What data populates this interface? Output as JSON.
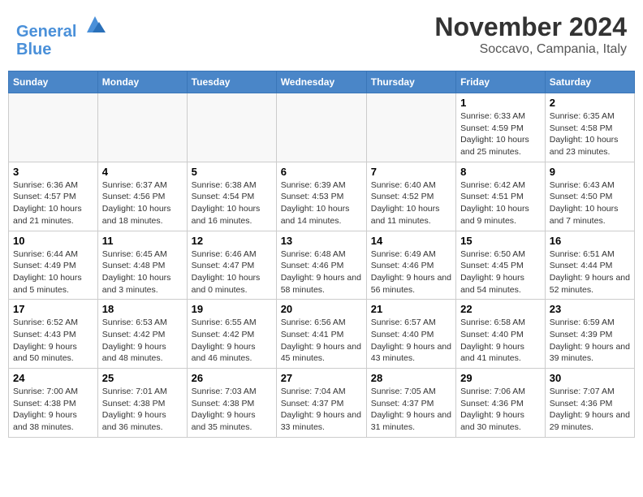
{
  "header": {
    "logo_line1": "General",
    "logo_line2": "Blue",
    "month_title": "November 2024",
    "location": "Soccavo, Campania, Italy"
  },
  "weekdays": [
    "Sunday",
    "Monday",
    "Tuesday",
    "Wednesday",
    "Thursday",
    "Friday",
    "Saturday"
  ],
  "weeks": [
    [
      {
        "day": "",
        "info": "",
        "empty": true
      },
      {
        "day": "",
        "info": "",
        "empty": true
      },
      {
        "day": "",
        "info": "",
        "empty": true
      },
      {
        "day": "",
        "info": "",
        "empty": true
      },
      {
        "day": "",
        "info": "",
        "empty": true
      },
      {
        "day": "1",
        "info": "Sunrise: 6:33 AM\nSunset: 4:59 PM\nDaylight: 10 hours and 25 minutes."
      },
      {
        "day": "2",
        "info": "Sunrise: 6:35 AM\nSunset: 4:58 PM\nDaylight: 10 hours and 23 minutes."
      }
    ],
    [
      {
        "day": "3",
        "info": "Sunrise: 6:36 AM\nSunset: 4:57 PM\nDaylight: 10 hours and 21 minutes."
      },
      {
        "day": "4",
        "info": "Sunrise: 6:37 AM\nSunset: 4:56 PM\nDaylight: 10 hours and 18 minutes."
      },
      {
        "day": "5",
        "info": "Sunrise: 6:38 AM\nSunset: 4:54 PM\nDaylight: 10 hours and 16 minutes."
      },
      {
        "day": "6",
        "info": "Sunrise: 6:39 AM\nSunset: 4:53 PM\nDaylight: 10 hours and 14 minutes."
      },
      {
        "day": "7",
        "info": "Sunrise: 6:40 AM\nSunset: 4:52 PM\nDaylight: 10 hours and 11 minutes."
      },
      {
        "day": "8",
        "info": "Sunrise: 6:42 AM\nSunset: 4:51 PM\nDaylight: 10 hours and 9 minutes."
      },
      {
        "day": "9",
        "info": "Sunrise: 6:43 AM\nSunset: 4:50 PM\nDaylight: 10 hours and 7 minutes."
      }
    ],
    [
      {
        "day": "10",
        "info": "Sunrise: 6:44 AM\nSunset: 4:49 PM\nDaylight: 10 hours and 5 minutes."
      },
      {
        "day": "11",
        "info": "Sunrise: 6:45 AM\nSunset: 4:48 PM\nDaylight: 10 hours and 3 minutes."
      },
      {
        "day": "12",
        "info": "Sunrise: 6:46 AM\nSunset: 4:47 PM\nDaylight: 10 hours and 0 minutes."
      },
      {
        "day": "13",
        "info": "Sunrise: 6:48 AM\nSunset: 4:46 PM\nDaylight: 9 hours and 58 minutes."
      },
      {
        "day": "14",
        "info": "Sunrise: 6:49 AM\nSunset: 4:46 PM\nDaylight: 9 hours and 56 minutes."
      },
      {
        "day": "15",
        "info": "Sunrise: 6:50 AM\nSunset: 4:45 PM\nDaylight: 9 hours and 54 minutes."
      },
      {
        "day": "16",
        "info": "Sunrise: 6:51 AM\nSunset: 4:44 PM\nDaylight: 9 hours and 52 minutes."
      }
    ],
    [
      {
        "day": "17",
        "info": "Sunrise: 6:52 AM\nSunset: 4:43 PM\nDaylight: 9 hours and 50 minutes."
      },
      {
        "day": "18",
        "info": "Sunrise: 6:53 AM\nSunset: 4:42 PM\nDaylight: 9 hours and 48 minutes."
      },
      {
        "day": "19",
        "info": "Sunrise: 6:55 AM\nSunset: 4:42 PM\nDaylight: 9 hours and 46 minutes."
      },
      {
        "day": "20",
        "info": "Sunrise: 6:56 AM\nSunset: 4:41 PM\nDaylight: 9 hours and 45 minutes."
      },
      {
        "day": "21",
        "info": "Sunrise: 6:57 AM\nSunset: 4:40 PM\nDaylight: 9 hours and 43 minutes."
      },
      {
        "day": "22",
        "info": "Sunrise: 6:58 AM\nSunset: 4:40 PM\nDaylight: 9 hours and 41 minutes."
      },
      {
        "day": "23",
        "info": "Sunrise: 6:59 AM\nSunset: 4:39 PM\nDaylight: 9 hours and 39 minutes."
      }
    ],
    [
      {
        "day": "24",
        "info": "Sunrise: 7:00 AM\nSunset: 4:38 PM\nDaylight: 9 hours and 38 minutes."
      },
      {
        "day": "25",
        "info": "Sunrise: 7:01 AM\nSunset: 4:38 PM\nDaylight: 9 hours and 36 minutes."
      },
      {
        "day": "26",
        "info": "Sunrise: 7:03 AM\nSunset: 4:38 PM\nDaylight: 9 hours and 35 minutes."
      },
      {
        "day": "27",
        "info": "Sunrise: 7:04 AM\nSunset: 4:37 PM\nDaylight: 9 hours and 33 minutes."
      },
      {
        "day": "28",
        "info": "Sunrise: 7:05 AM\nSunset: 4:37 PM\nDaylight: 9 hours and 31 minutes."
      },
      {
        "day": "29",
        "info": "Sunrise: 7:06 AM\nSunset: 4:36 PM\nDaylight: 9 hours and 30 minutes."
      },
      {
        "day": "30",
        "info": "Sunrise: 7:07 AM\nSunset: 4:36 PM\nDaylight: 9 hours and 29 minutes."
      }
    ]
  ]
}
